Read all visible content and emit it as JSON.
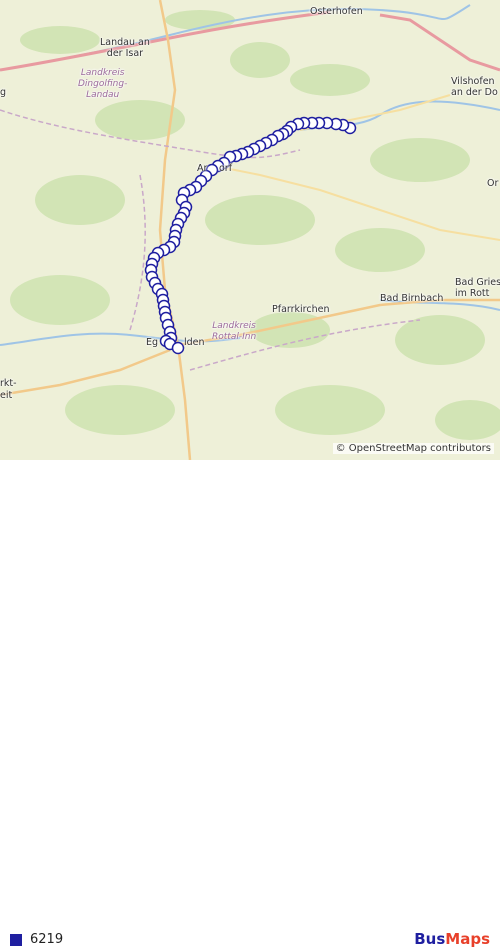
{
  "map": {
    "places": [
      {
        "key": "osterhofen",
        "text": "Osterhofen"
      },
      {
        "key": "landau",
        "text": "Landau an\nder Isar"
      },
      {
        "key": "landkreis_dingolfing",
        "text": "Landkreis\nDingolfing-\nLandau"
      },
      {
        "key": "vilshofen",
        "text": "Vilshofen\nan der Do"
      },
      {
        "key": "arnstorf_a",
        "text": "Ar"
      },
      {
        "key": "arnstorf_b",
        "text": "orf"
      },
      {
        "key": "or",
        "text": "Or"
      },
      {
        "key": "bad_griesbach",
        "text": "Bad Gries\nim Rott"
      },
      {
        "key": "bad_birnbach",
        "text": "Bad Birnbach"
      },
      {
        "key": "pfarrkirchen",
        "text": "Pfarrkirchen"
      },
      {
        "key": "landkreis_rottal",
        "text": "Landkreis\nRottal-Inn"
      },
      {
        "key": "eggenfelden_a",
        "text": "Eg"
      },
      {
        "key": "eggenfelden_b",
        "text": "lden"
      },
      {
        "key": "markt_a",
        "text": "rkt-"
      },
      {
        "key": "markt_b",
        "text": "eit"
      },
      {
        "key": "g",
        "text": "g"
      }
    ],
    "attribution": "© OpenStreetMap contributors"
  },
  "route": {
    "color": "#1f1fa0",
    "stop_count": 56
  },
  "legend": {
    "route_name": "6219",
    "swatch_color": "#1f1fa0"
  },
  "brand": {
    "part1": "Bus",
    "part2": "Maps",
    "color1": "#1f1fa0",
    "color2": "#e8402a"
  }
}
